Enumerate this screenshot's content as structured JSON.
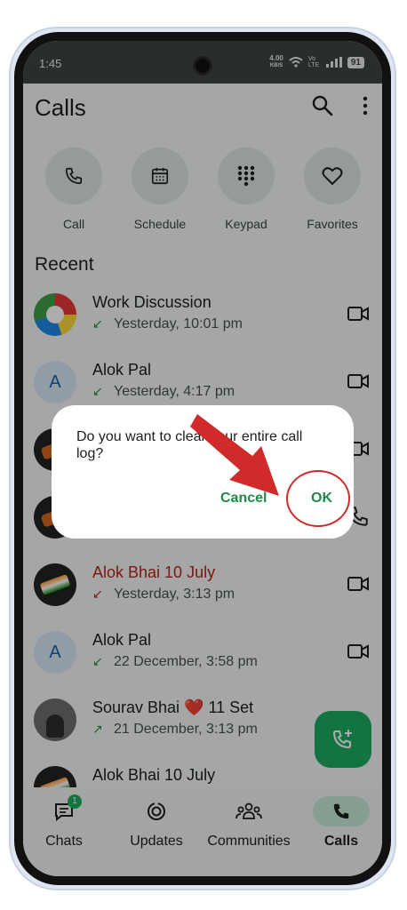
{
  "status_bar": {
    "time": "1:45",
    "speed": "4.00",
    "speed_unit": "KB/S",
    "network": "Vo LTE",
    "battery": "91"
  },
  "header": {
    "title": "Calls",
    "search_icon": "search-icon",
    "more_icon": "more-vert-icon"
  },
  "quick_actions": [
    {
      "label": "Call",
      "icon": "phone-icon"
    },
    {
      "label": "Schedule",
      "icon": "calendar-icon"
    },
    {
      "label": "Keypad",
      "icon": "dialpad-icon"
    },
    {
      "label": "Favorites",
      "icon": "heart-icon"
    }
  ],
  "recent": {
    "title": "Recent",
    "calls": [
      {
        "name": "Work Discussion",
        "direction": "incoming",
        "time": "Yesterday, 10:01 pm",
        "type": "video",
        "avatar": "group-logo"
      },
      {
        "name": "Alok Pal",
        "direction": "incoming",
        "time": "Yesterday, 4:17 pm",
        "type": "video",
        "avatar_letter": "A"
      },
      {
        "name": "",
        "direction": "incoming",
        "time": "",
        "type": "video",
        "avatar": "photo"
      },
      {
        "name": "",
        "direction": "incoming",
        "time": "",
        "type": "voice",
        "avatar": "photo"
      },
      {
        "name": "Alok Bhai 10 July",
        "direction": "missed",
        "time": "Yesterday, 3:13 pm",
        "type": "video",
        "avatar": "photo"
      },
      {
        "name": "Alok Pal",
        "direction": "incoming",
        "time": "22 December, 3:58 pm",
        "type": "video",
        "avatar_letter": "A"
      },
      {
        "name": "Sourav Bhai ❤️ 11 Set",
        "direction": "outgoing",
        "time": "21 December, 3:13 pm",
        "type": "video",
        "avatar": "photo"
      },
      {
        "name": "Alok Bhai 10 July",
        "direction": "incoming",
        "time": "",
        "type": "video",
        "avatar": "photo"
      }
    ]
  },
  "fab": {
    "icon": "add-call-icon"
  },
  "bottom_nav": [
    {
      "label": "Chats",
      "icon": "chat-icon",
      "badge": "1",
      "active": false
    },
    {
      "label": "Updates",
      "icon": "updates-icon",
      "active": false
    },
    {
      "label": "Communities",
      "icon": "communities-icon",
      "active": false
    },
    {
      "label": "Calls",
      "icon": "phone-icon",
      "active": true
    }
  ],
  "dialog": {
    "message": "Do you want to clear your entire call log?",
    "cancel_label": "Cancel",
    "ok_label": "OK"
  },
  "colors": {
    "accent": "#1e8a47",
    "fab": "#1daa61",
    "missed": "#b3261e",
    "annotation": "#d12a2a"
  }
}
